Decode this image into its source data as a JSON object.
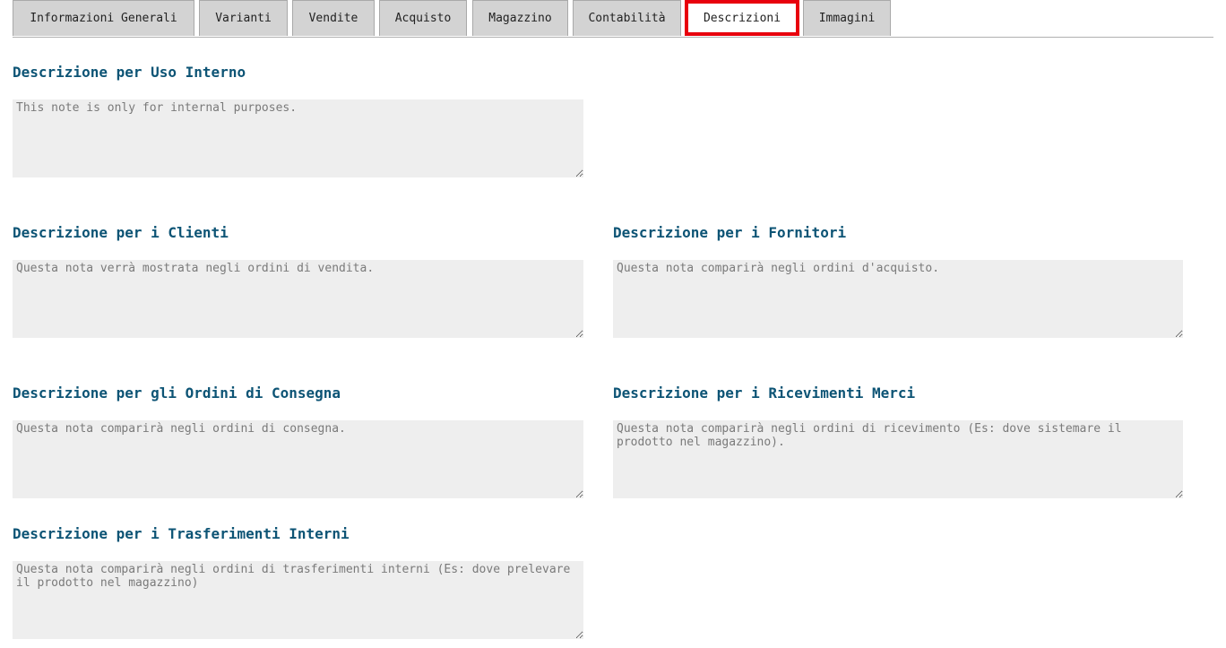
{
  "tabs": [
    {
      "label": "Informazioni Generali"
    },
    {
      "label": "Varianti"
    },
    {
      "label": "Vendite"
    },
    {
      "label": "Acquisto"
    },
    {
      "label": "Magazzino"
    },
    {
      "label": "Contabilità"
    },
    {
      "label": "Descrizioni",
      "active": true
    },
    {
      "label": "Immagini"
    }
  ],
  "sections": {
    "internal": {
      "title": "Descrizione per Uso Interno",
      "placeholder": "This note is only for internal purposes.",
      "value": ""
    },
    "customers": {
      "title": "Descrizione per i Clienti",
      "placeholder": "Questa nota verrà mostrata negli ordini di vendita.",
      "value": ""
    },
    "suppliers": {
      "title": "Descrizione per i Fornitori",
      "placeholder": "Questa nota comparirà negli ordini d'acquisto.",
      "value": ""
    },
    "delivery": {
      "title": "Descrizione per gli Ordini di Consegna",
      "placeholder": "Questa nota comparirà negli ordini di consegna.",
      "value": ""
    },
    "receipts": {
      "title": "Descrizione per i Ricevimenti Merci",
      "placeholder": "Questa nota comparirà negli ordini di ricevimento (Es: dove sistemare il prodotto nel magazzino).",
      "value": ""
    },
    "transfers": {
      "title": "Descrizione per i Trasferimenti Interni",
      "placeholder": "Questa nota comparirà negli ordini di trasferimenti interni (Es: dove prelevare il prodotto nel magazzino)",
      "value": ""
    }
  },
  "colors": {
    "section_title": "#0d5475",
    "active_tab_border": "#e8000d",
    "tab_background": "#d3d3d3",
    "field_background": "#eeeeee"
  }
}
